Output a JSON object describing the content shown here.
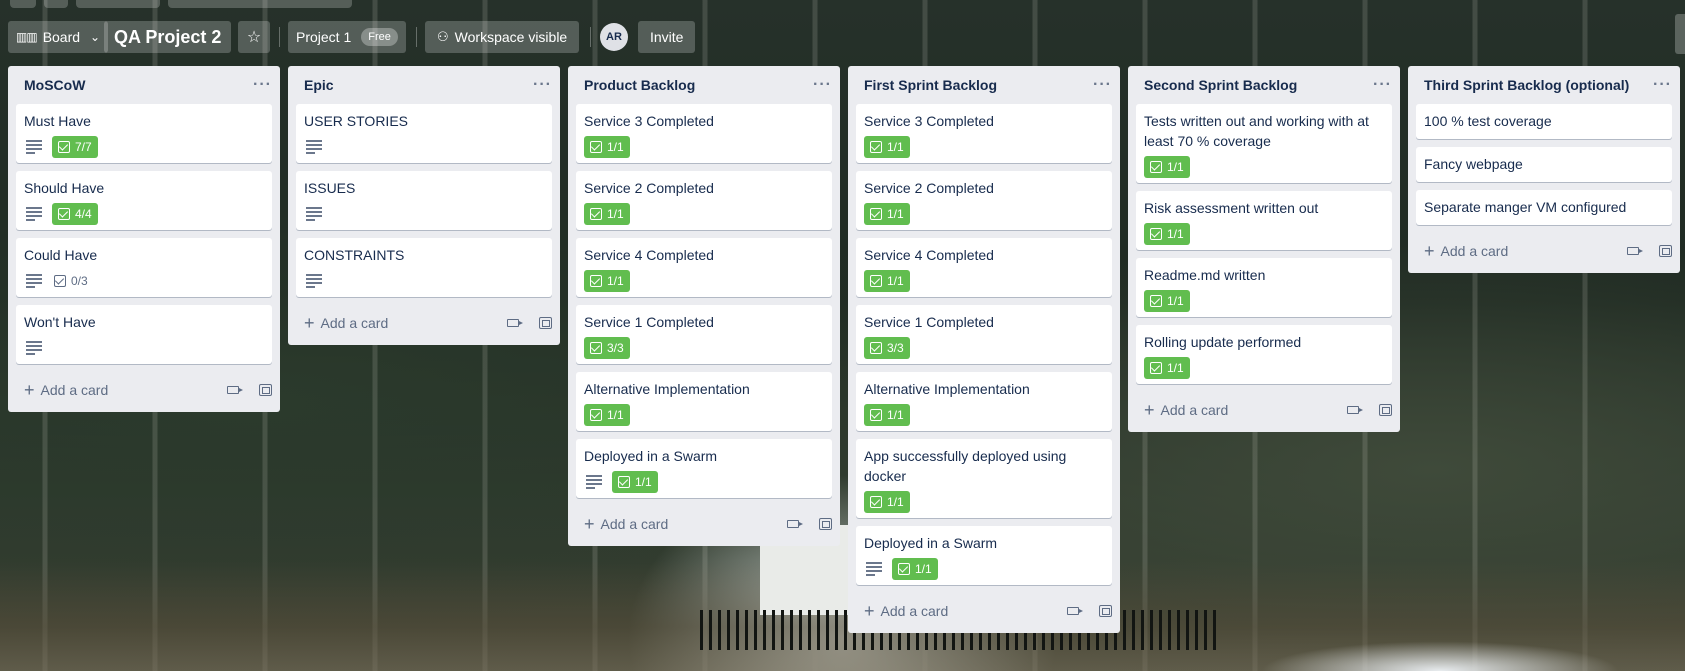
{
  "header": {
    "board_view_label": "Board",
    "board_title": "QA Project 2",
    "workspace_label": "Project 1",
    "workspace_badge": "Free",
    "visibility_label": "Workspace visible",
    "avatar_initials": "AR",
    "invite_label": "Invite"
  },
  "add_card_label": "Add a card",
  "lists": [
    {
      "title": "MoSCoW",
      "cards": [
        {
          "title": "Must Have",
          "description": true,
          "checklist": "7/7",
          "complete": true
        },
        {
          "title": "Should Have",
          "description": true,
          "checklist": "4/4",
          "complete": true
        },
        {
          "title": "Could Have",
          "description": true,
          "checklist": "0/3",
          "complete": false
        },
        {
          "title": "Won't Have",
          "description": true,
          "checklist": "",
          "complete": false
        }
      ]
    },
    {
      "title": "Epic",
      "cards": [
        {
          "title": "USER STORIES",
          "description": true,
          "checklist": "",
          "complete": false
        },
        {
          "title": "ISSUES",
          "description": true,
          "checklist": "",
          "complete": false
        },
        {
          "title": "CONSTRAINTS",
          "description": true,
          "checklist": "",
          "complete": false
        }
      ]
    },
    {
      "title": "Product Backlog",
      "cards": [
        {
          "title": "Service 3 Completed",
          "description": false,
          "checklist": "1/1",
          "complete": true
        },
        {
          "title": "Service 2 Completed",
          "description": false,
          "checklist": "1/1",
          "complete": true
        },
        {
          "title": "Service 4 Completed",
          "description": false,
          "checklist": "1/1",
          "complete": true
        },
        {
          "title": "Service 1 Completed",
          "description": false,
          "checklist": "3/3",
          "complete": true
        },
        {
          "title": "Alternative Implementation",
          "description": false,
          "checklist": "1/1",
          "complete": true
        },
        {
          "title": "Deployed in a Swarm",
          "description": true,
          "checklist": "1/1",
          "complete": true
        }
      ]
    },
    {
      "title": "First Sprint Backlog",
      "cards": [
        {
          "title": "Service 3 Completed",
          "description": false,
          "checklist": "1/1",
          "complete": true
        },
        {
          "title": "Service 2 Completed",
          "description": false,
          "checklist": "1/1",
          "complete": true
        },
        {
          "title": "Service 4 Completed",
          "description": false,
          "checklist": "1/1",
          "complete": true
        },
        {
          "title": "Service 1 Completed",
          "description": false,
          "checklist": "3/3",
          "complete": true
        },
        {
          "title": "Alternative Implementation",
          "description": false,
          "checklist": "1/1",
          "complete": true
        },
        {
          "title": "App successfully deployed using docker",
          "description": false,
          "checklist": "1/1",
          "complete": true
        },
        {
          "title": "Deployed in a Swarm",
          "description": true,
          "checklist": "1/1",
          "complete": true
        }
      ]
    },
    {
      "title": "Second Sprint Backlog",
      "cards": [
        {
          "title": "Tests written out and working with at least 70 % coverage",
          "description": false,
          "checklist": "1/1",
          "complete": true
        },
        {
          "title": "Risk assessment written out",
          "description": false,
          "checklist": "1/1",
          "complete": true
        },
        {
          "title": "Readme.md written",
          "description": false,
          "checklist": "1/1",
          "complete": true
        },
        {
          "title": "Rolling update performed",
          "description": false,
          "checklist": "1/1",
          "complete": true
        }
      ]
    },
    {
      "title": "Third Sprint Backlog (optional)",
      "cards": [
        {
          "title": "100 % test coverage",
          "description": false,
          "checklist": "",
          "complete": false
        },
        {
          "title": "Fancy webpage",
          "description": false,
          "checklist": "",
          "complete": false
        },
        {
          "title": "Separate manger VM configured",
          "description": false,
          "checklist": "",
          "complete": false
        }
      ]
    }
  ]
}
